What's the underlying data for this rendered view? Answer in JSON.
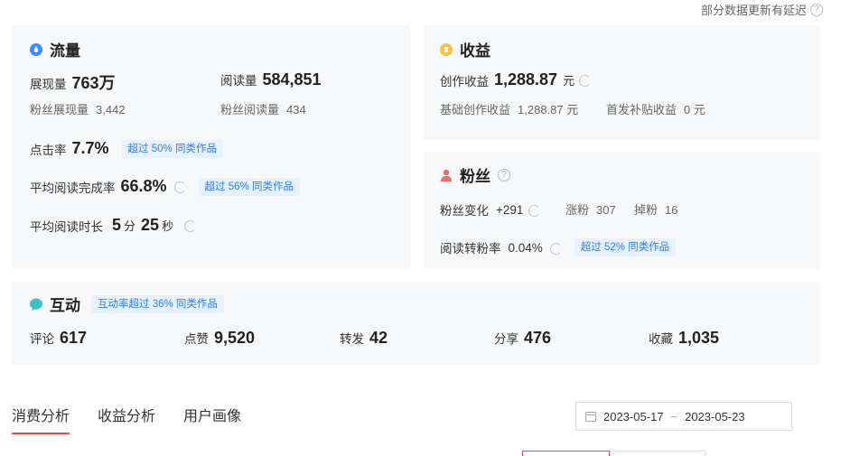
{
  "notice": {
    "text": "部分数据更新有延迟",
    "help_icon": "?"
  },
  "traffic": {
    "title": "流量",
    "impressions_label": "展现量",
    "impressions_value": "763万",
    "reads_label": "阅读量",
    "reads_value": "584,851",
    "fan_impressions_label": "粉丝展现量",
    "fan_impressions_value": "3,442",
    "fan_reads_label": "粉丝阅读量",
    "fan_reads_value": "434",
    "ctr_label": "点击率",
    "ctr_value": "7.7%",
    "ctr_tag": "超过 50% 同类作品",
    "completion_label": "平均阅读完成率",
    "completion_value": "66.8%",
    "completion_tag": "超过 56% 同类作品",
    "duration_label": "平均阅读时长",
    "duration_min": "5",
    "duration_min_unit": "分",
    "duration_sec": "25",
    "duration_sec_unit": "秒"
  },
  "income": {
    "title": "收益",
    "creation_label": "创作收益",
    "creation_value": "1,288.87",
    "creation_unit": "元",
    "basic_label": "基础创作收益",
    "basic_value": "1,288.87 元",
    "subsidy_label": "首发补贴收益",
    "subsidy_value": "0 元"
  },
  "fans": {
    "title": "粉丝",
    "change_label": "粉丝变化",
    "change_value": "+291",
    "gain_label": "涨粉",
    "gain_value": "307",
    "loss_label": "掉粉",
    "loss_value": "16",
    "conversion_label": "阅读转粉率",
    "conversion_value": "0.04%",
    "conversion_tag": "超过 52% 同类作品"
  },
  "interaction": {
    "title": "互动",
    "tag": "互动率超过 36% 同类作品",
    "comments_label": "评论",
    "comments_value": "617",
    "likes_label": "点赞",
    "likes_value": "9,520",
    "reposts_label": "转发",
    "reposts_value": "42",
    "shares_label": "分享",
    "shares_value": "476",
    "favorites_label": "收藏",
    "favorites_value": "1,035"
  },
  "tabs": [
    "消费分析",
    "收益分析",
    "用户画像"
  ],
  "date_range": {
    "start": "2023-05-17",
    "separator": "~",
    "end": "2023-05-23"
  },
  "colors": {
    "accent_red": "#e94e4e",
    "tag_blue": "#2f7df6",
    "icon_traffic": "#3d8ef8",
    "icon_income": "#f7c340",
    "icon_fans": "#f06a6a",
    "icon_interaction": "#3cc2c8"
  }
}
